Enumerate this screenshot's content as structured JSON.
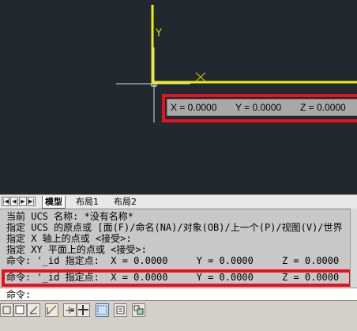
{
  "viewport": {
    "ucs_y_label": "Y",
    "ucs_x_label": "X",
    "coord_readout": {
      "x": "X = 0.0000",
      "y": "Y = 0.0000",
      "z": "Z = 0.0000"
    }
  },
  "tabs": [
    {
      "label": "模型",
      "active": true
    },
    {
      "label": "布局1",
      "active": false
    },
    {
      "label": "布局2",
      "active": false
    }
  ],
  "command_history": [
    "当前 UCS 名称: *没有名称*",
    "指定 UCS 的原点或 [面(F)/命名(NA)/对象(OB)/上一个(P)/视图(V)/世界",
    "指定 X 轴上的点或 <接受>:",
    "指定 XY 平面上的点或 <接受>:",
    "命令: '_id 指定点:  X = 0.0000     Y = 0.0000     Z = 0.0000",
    "命令: '_id 指定点:  X = 0.0000     Y = 0.0000     Z = 0.0000"
  ],
  "command_prompt": "命令:",
  "colors": {
    "highlight": "#e8101a",
    "axis": "#f0f000",
    "background": "#212830"
  },
  "status_icons": [
    "snap-icon",
    "grid-icon",
    "ortho-icon",
    "polar-icon",
    "osnap-icon",
    "otrack-icon",
    "ducs-icon",
    "dyn-icon",
    "lineweight-icon",
    "quickprops-icon"
  ]
}
